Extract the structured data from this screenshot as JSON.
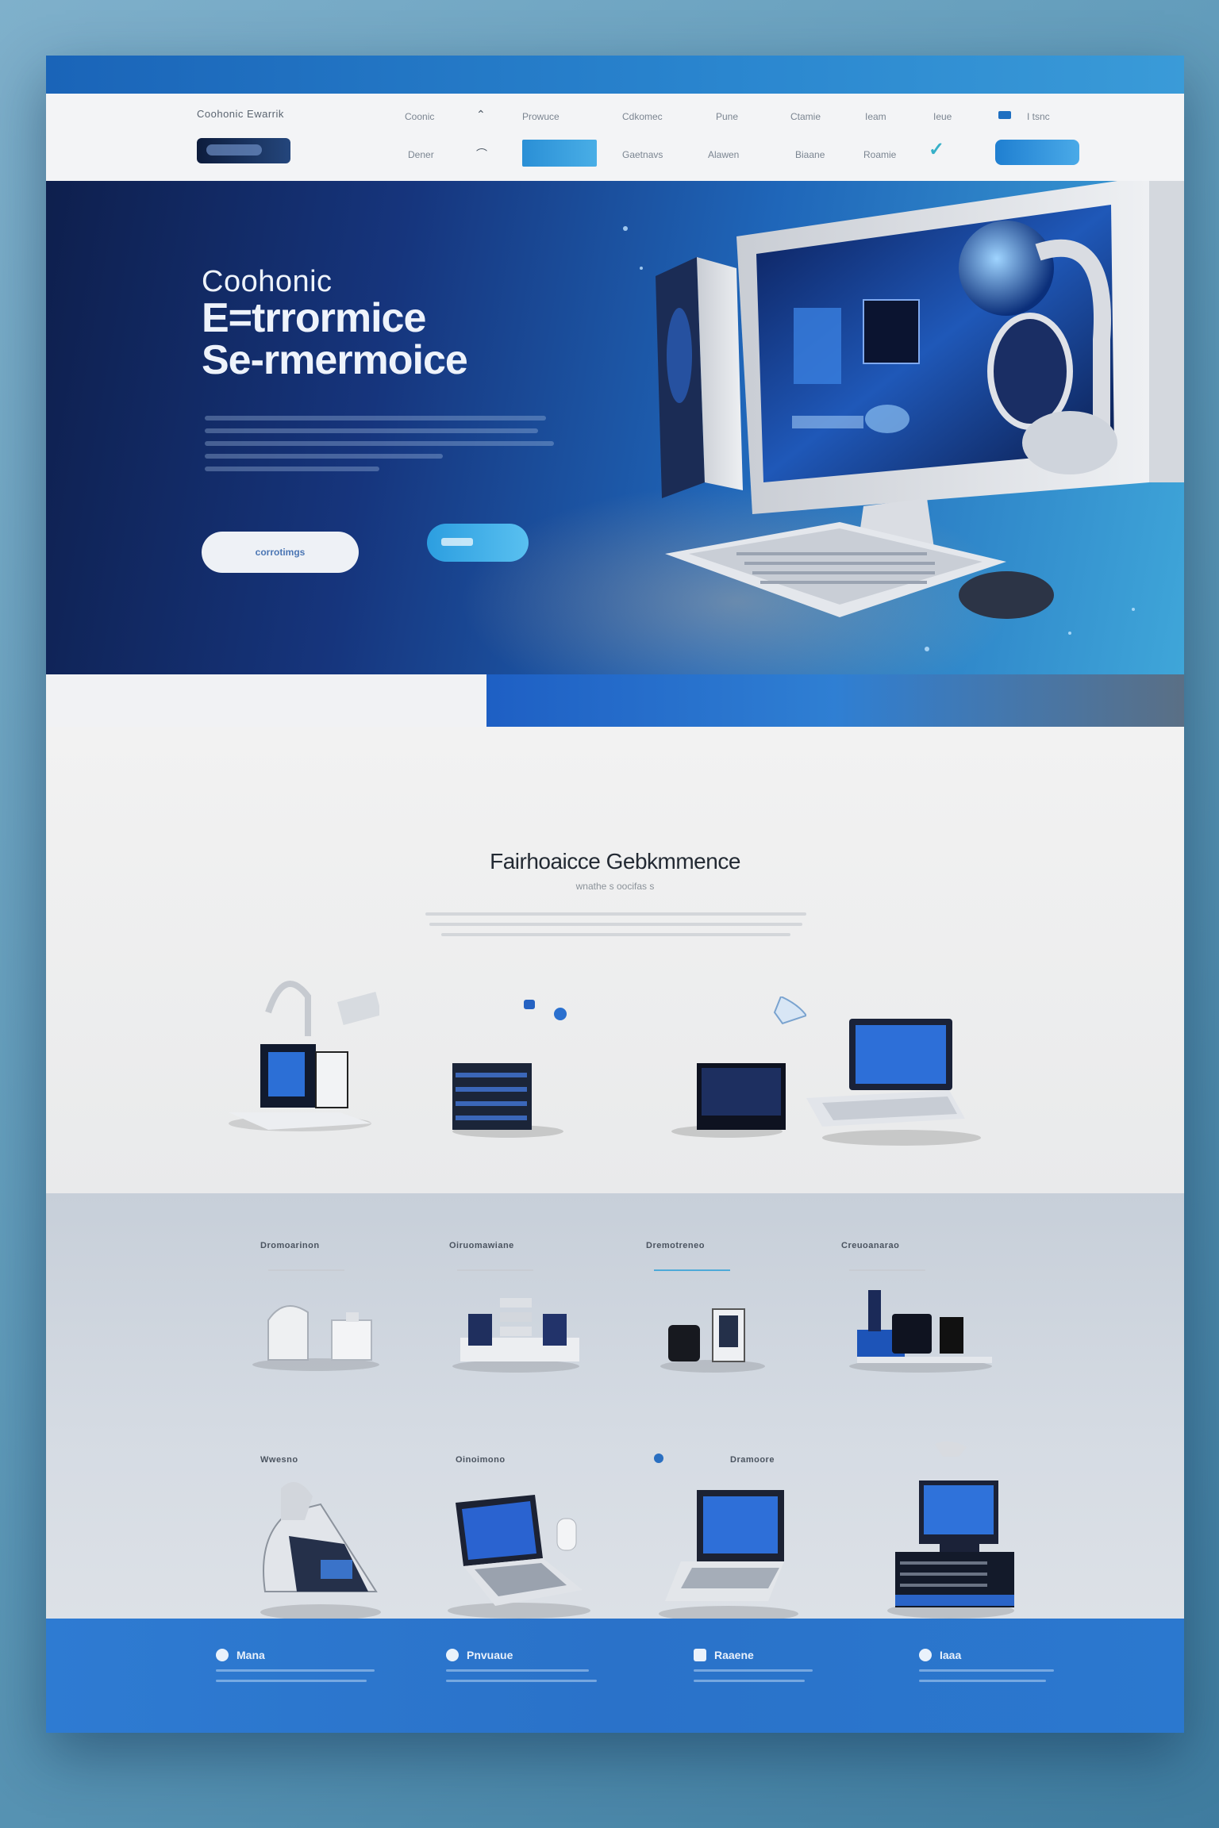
{
  "nav": {
    "brand": "Coohonic Ewarrik",
    "links_top": [
      "Coonic",
      "Prowuce",
      "Cdkomec",
      "Pune",
      "Ctamie",
      "Ieam",
      "Ieue",
      "I tsnc"
    ],
    "links_bottom": [
      "Dener",
      "Gaetnavs",
      "Alawen",
      "Biaane",
      "Roamie"
    ]
  },
  "hero": {
    "title_line1": "Coohonic",
    "title_line2": "E=trrormice",
    "title_line3": "Se-rmermoice",
    "button_label": "corrotimgs"
  },
  "featured": {
    "title": "Fairhoaicce Gebkmmence",
    "subtitle": "wnathe s oocifas s"
  },
  "categories": [
    "Dromoarinon",
    "Oiruomawiane",
    "Dremotreneo",
    "Creuoanarao"
  ],
  "product_labels_row2": [
    "Wwesno",
    "Oinoimono",
    "Dramoore"
  ],
  "footer": {
    "columns": [
      "Mana",
      "Pnvuaue",
      "Raaene",
      "Iaaa"
    ]
  },
  "colors": {
    "accent": "#2a7bd2",
    "hero_dark": "#0e1f4d",
    "hero_light": "#3fa6d9",
    "footer": "#2e7bd2"
  }
}
